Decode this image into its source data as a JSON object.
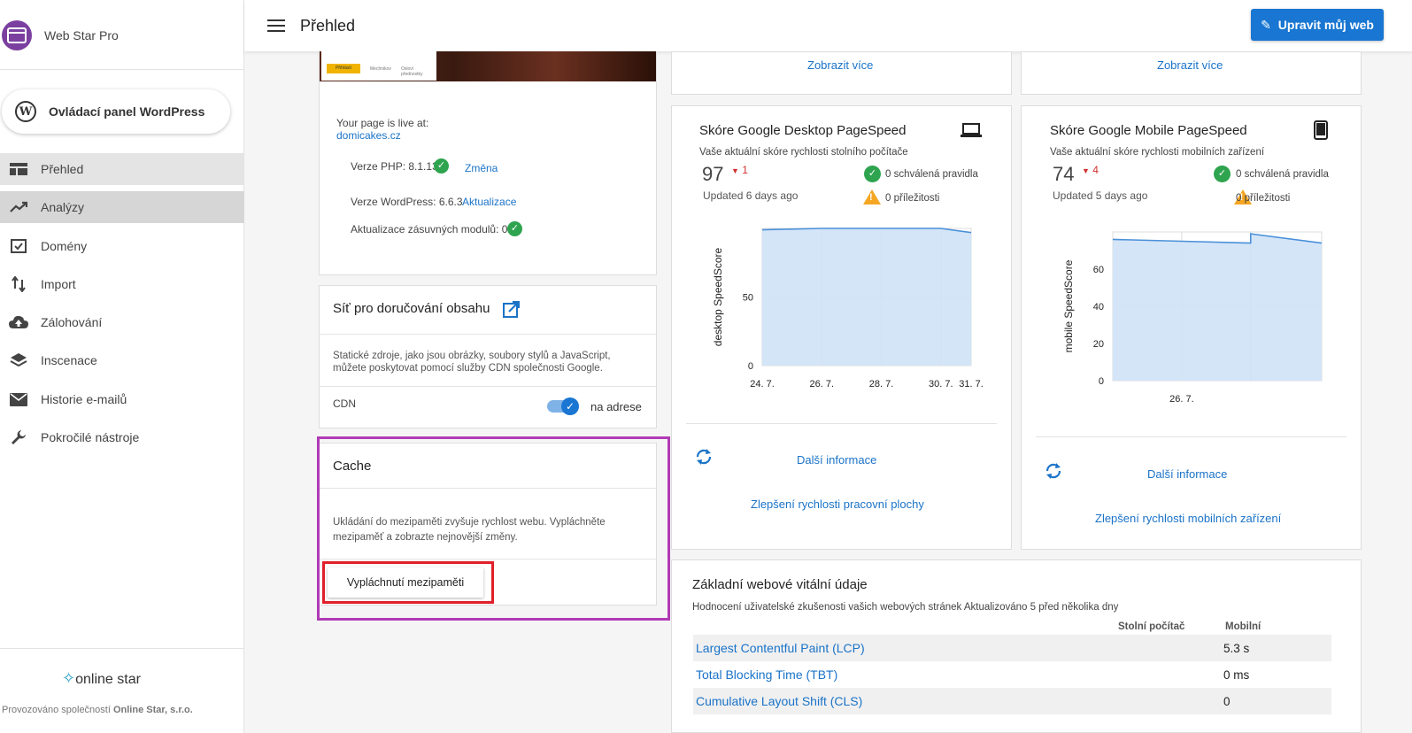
{
  "sidebar": {
    "brand": "Web Star Pro",
    "wp_button": "Ovládací panel WordPress",
    "items": [
      {
        "label": "Přehled",
        "icon": "dashboard-icon"
      },
      {
        "label": "Analýzy",
        "icon": "trending-up-icon"
      },
      {
        "label": "Domény",
        "icon": "checkbox-icon"
      },
      {
        "label": "Import",
        "icon": "import-arrows-icon"
      },
      {
        "label": "Zálohování",
        "icon": "cloud-upload-icon"
      },
      {
        "label": "Inscenace",
        "icon": "layers-icon"
      },
      {
        "label": "Historie e-mailů",
        "icon": "mail-icon"
      },
      {
        "label": "Pokročilé nástroje",
        "icon": "wrench-icon"
      }
    ],
    "footer_logo": "online star",
    "footer_text_prefix": "Provozováno společností ",
    "footer_text_company": "Online Star, s.r.o."
  },
  "header": {
    "title": "Přehled",
    "edit_button": "Upravit můj web"
  },
  "site": {
    "live_label": "Your page is live at:",
    "domain": "domicakes.cz",
    "php_label": "Verze PHP:",
    "php_version": "8.1.13",
    "php_change": "Změna",
    "wp_label": "Verze WordPress:",
    "wp_version": "6.6.3",
    "wp_update": "Aktualizace",
    "plugins_label": "Aktualizace zásuvných modulů:",
    "plugins_count": "0",
    "preview_btn1": "Přihlásit",
    "preview_btn2": "Mechnikov",
    "preview_btn3": "Osloví přednostky"
  },
  "cdn": {
    "title": "Síť pro doručování obsahu",
    "description": "Statické zdroje, jako jsou obrázky, soubory stylů a JavaScript, můžete poskytovat pomocí služby CDN společnosti Google.",
    "label": "CDN",
    "toggle_label": "na adrese",
    "enabled": true
  },
  "cache": {
    "title": "Cache",
    "description": "Ukládání do mezipaměti zvyšuje rychlost webu. Vypláchněte mezipaměť a zobrazte nejnovější změny.",
    "button": "Vypláchnutí mezipaměti"
  },
  "top_links": {
    "left": "Zobrazit více",
    "right": "Zobrazit více"
  },
  "desktop": {
    "title": "Skóre Google Desktop PageSpeed",
    "subtitle": "Vaše aktuální skóre rychlosti stolního počítače",
    "score": "97",
    "delta": "1",
    "updated": "Updated 6 days ago",
    "approved": "0 schválená pravidla",
    "opportunities": "0 příležitosti",
    "more_info": "Další informace",
    "improve": "Zlepšení rychlosti pracovní plochy"
  },
  "mobile": {
    "title": "Skóre Google Mobile PageSpeed",
    "subtitle": "Vaše aktuální skóre rychlosti mobilních zařízení",
    "score": "74",
    "delta": "4",
    "updated": "Updated 5 days ago",
    "approved": "0 schválená pravidla",
    "opportunities": "0 příležitosti",
    "more_info": "Další informace",
    "improve": "Zlepšení rychlosti mobilních zařízení"
  },
  "chart_data": [
    {
      "type": "area",
      "ylabel": "desktop SpeedScore",
      "x": [
        "24. 7.",
        "26. 7.",
        "28. 7.",
        "30. 7.",
        "31. 7."
      ],
      "series": [
        {
          "values": [
            99,
            100,
            100,
            100,
            97
          ]
        }
      ],
      "ylim": [
        0,
        100
      ],
      "yticks": [
        0,
        50
      ],
      "grid": true,
      "color": "#4a90d9"
    },
    {
      "type": "area",
      "ylabel": "mobile SpeedScore",
      "x": [
        "",
        "26. 7.",
        "",
        "",
        ""
      ],
      "series": [
        {
          "values": [
            76,
            75,
            74,
            79,
            74
          ]
        }
      ],
      "ylim": [
        0,
        80
      ],
      "yticks": [
        0,
        20,
        40,
        60
      ],
      "grid": true,
      "color": "#4a90d9"
    }
  ],
  "vitals": {
    "title": "Základní webové vitální údaje",
    "subtitle": "Hodnocení uživatelské zkušenosti vašich webových stránek Aktualizováno 5 před několika dny",
    "col_desktop": "Stolní počítač",
    "col_mobile": "Mobilní",
    "rows": [
      {
        "name": "Largest Contentful Paint (LCP)",
        "desktop": "",
        "mobile": "5.3 s"
      },
      {
        "name": "Total Blocking Time (TBT)",
        "desktop": "",
        "mobile": "0 ms"
      },
      {
        "name": "Cumulative Layout Shift (CLS)",
        "desktop": "",
        "mobile": "0"
      }
    ]
  },
  "colors": {
    "accent": "#1976d2",
    "highlight_purple": "#b03bb5",
    "highlight_red": "#e0202a",
    "ok": "#2ea44f",
    "warn": "#f5a623",
    "down": "#d32f2f"
  }
}
